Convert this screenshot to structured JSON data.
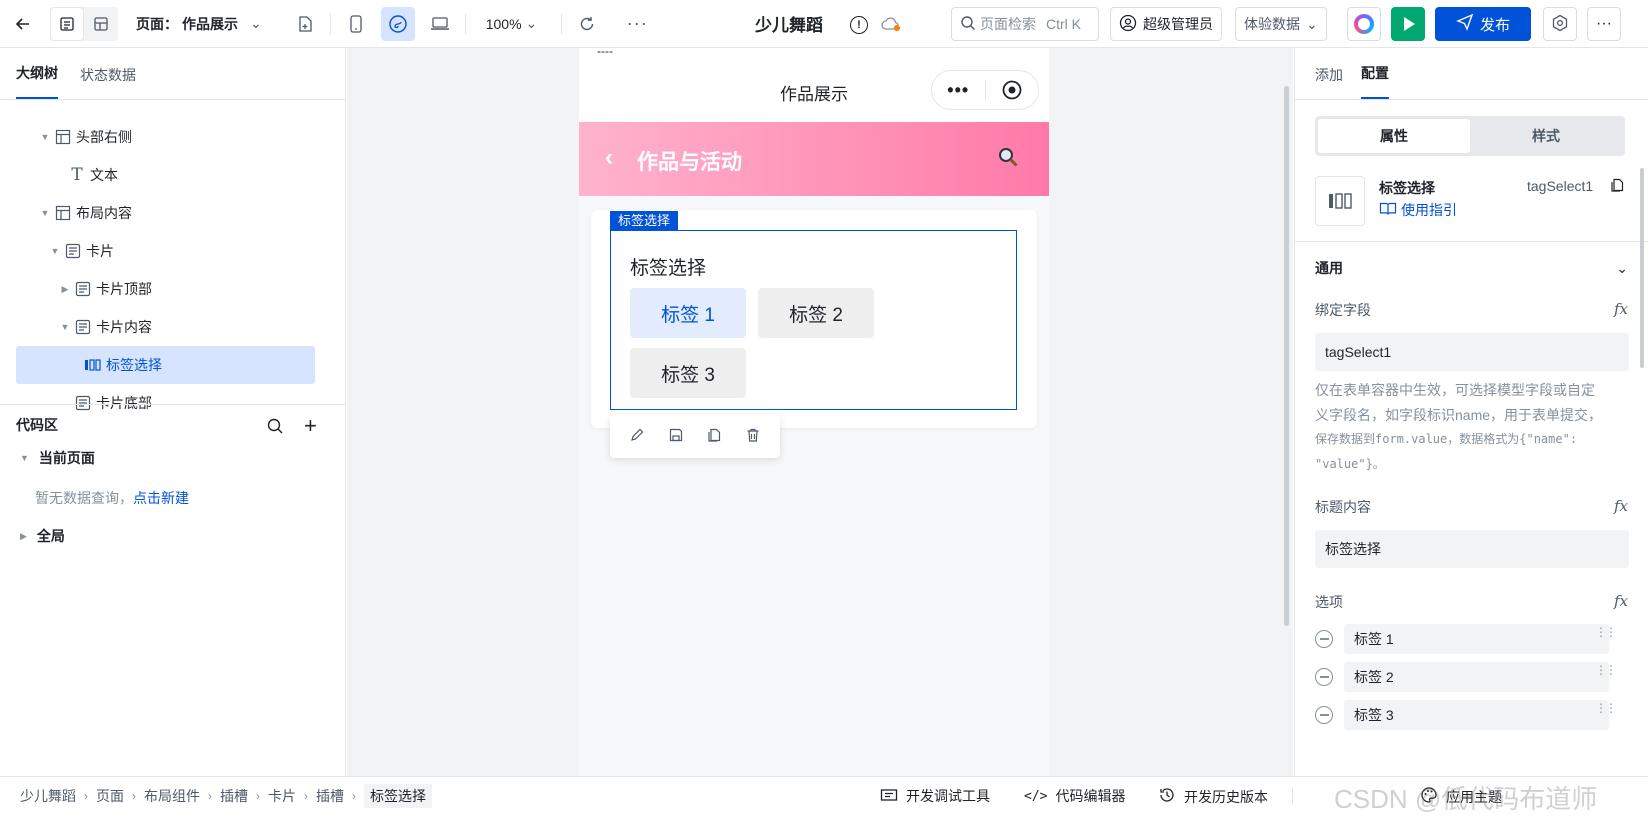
{
  "topbar": {
    "page_prefix": "页面：",
    "page_name": "作品展示",
    "zoom": "100%",
    "app_name": "少儿舞蹈",
    "search_placeholder": "页面检索",
    "search_shortcut": "Ctrl K",
    "user_role": "超级管理员",
    "data_mode": "体验数据",
    "publish_label": "发布"
  },
  "left_panel": {
    "tabs": [
      "大纲树",
      "状态数据"
    ],
    "tree": [
      {
        "label": "头部右侧",
        "icon": "layout-icon",
        "caret": "▼"
      },
      {
        "label": "文本",
        "icon": "text-icon",
        "caret": ""
      },
      {
        "label": "布局内容",
        "icon": "layout-icon",
        "caret": "▼"
      },
      {
        "label": "卡片",
        "icon": "card-icon",
        "caret": "▼"
      },
      {
        "label": "卡片顶部",
        "icon": "card-icon",
        "caret": "▶"
      },
      {
        "label": "卡片内容",
        "icon": "card-icon",
        "caret": "▼"
      },
      {
        "label": "标签选择",
        "icon": "tag-select-icon",
        "caret": ""
      },
      {
        "label": "卡片底部",
        "icon": "card-icon",
        "caret": ""
      }
    ],
    "code": {
      "title": "代码区",
      "current_page": "当前页面",
      "empty_text": "暂无数据查询，",
      "create_link": "点击新建",
      "global": "全局"
    }
  },
  "phone": {
    "dots_top": "----",
    "nav_title": "作品展示",
    "header_title": "作品与活动",
    "selected_tag": "标签选择",
    "component_title": "标签选择",
    "tags": [
      "标签 1",
      "标签 2",
      "标签 3"
    ],
    "active_tag_index": 0
  },
  "right_panel": {
    "tabs": [
      "添加",
      "配置"
    ],
    "segments": [
      "属性",
      "样式"
    ],
    "component_name": "标签选择",
    "component_id": "tagSelect1",
    "guide_link": "使用指引",
    "section": "通用",
    "bind_label": "绑定字段",
    "bind_value": "tagSelect1",
    "bind_help_1": "仅在表单容器中生效，可选择模型字段或自定",
    "bind_help_2": "义字段名，如字段标识name，用于表单提交，",
    "bind_help_3": "保存数据到form.value，数据格式为{\"name\":",
    "bind_help_4": "\"value\"}。",
    "title_label": "标题内容",
    "title_value": "标签选择",
    "options_label": "选项",
    "options": [
      "标签 1",
      "标签 2",
      "标签 3"
    ]
  },
  "bottom": {
    "breadcrumb": [
      "少儿舞蹈",
      "页面",
      "布局组件",
      "插槽",
      "卡片",
      "插槽",
      "标签选择"
    ],
    "debug_tools": "开发调试工具",
    "code_editor": "代码编辑器",
    "history": "开发历史版本",
    "theme": "应用主题",
    "watermark": "CSDN @低代码布道师"
  },
  "colors": {
    "primary": "#0052d9",
    "pink_start": "#ffb3cd",
    "pink_end": "#ff7aa8",
    "green": "#00a870"
  }
}
